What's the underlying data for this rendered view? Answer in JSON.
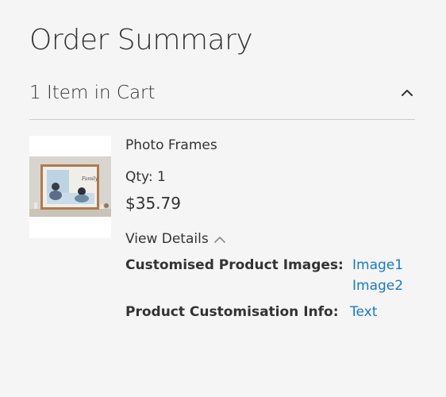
{
  "summary": {
    "title": "Order Summary",
    "cart_count_label": "1 Item in Cart",
    "toggle_icon": "chevron-up-icon"
  },
  "item": {
    "name": "Photo Frames",
    "qty_label": "Qty: 1",
    "price": "$35.79",
    "view_details_label": "View Details",
    "thumbnail_caption": "Family",
    "options": [
      {
        "label": "Customised Product Images:",
        "links": [
          "Image1",
          "Image2"
        ]
      },
      {
        "label": "Product Customisation Info:",
        "links": [
          "Text"
        ]
      }
    ]
  },
  "colors": {
    "background": "#f5f5f5",
    "text": "#333333",
    "link": "#1979c3",
    "divider": "#cccccc"
  }
}
